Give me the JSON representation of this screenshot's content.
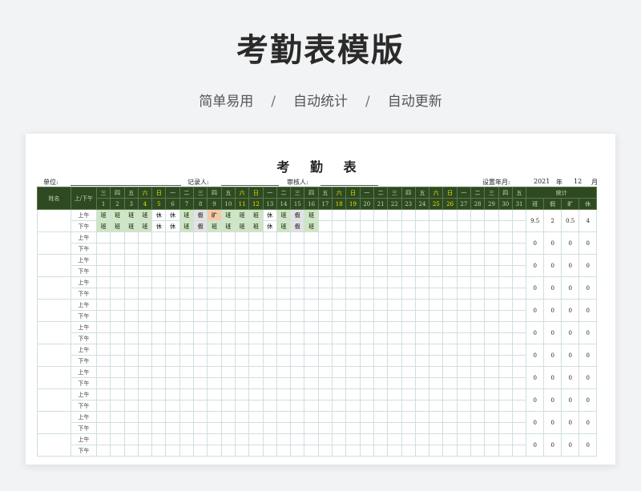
{
  "title": "考勤表模版",
  "subtitle": {
    "items": [
      "简单易用",
      "自动统计",
      "自动更新"
    ],
    "separator": "/"
  },
  "sheet": {
    "title": "考 勤 表",
    "unit_label": "单位:",
    "recorder_label": "记录人:",
    "reviewer_label": "审核人:",
    "set_label": "设置年月:",
    "year": "2021",
    "year_unit": "年",
    "month": "12",
    "month_unit": "月",
    "name_header": "姓名",
    "half_header": "上/下午",
    "stats_header": "统计",
    "stat_cols": [
      "班",
      "假",
      "旷",
      "休"
    ],
    "weekdays": [
      "三",
      "四",
      "五",
      "六",
      "日",
      "一",
      "二",
      "三",
      "四",
      "五",
      "六",
      "日",
      "一",
      "二",
      "三",
      "四",
      "五",
      "六",
      "日",
      "一",
      "二",
      "三",
      "四",
      "五",
      "六",
      "日",
      "一",
      "二",
      "三",
      "四",
      "五"
    ],
    "days": [
      "1",
      "2",
      "3",
      "4",
      "5",
      "6",
      "7",
      "8",
      "9",
      "10",
      "11",
      "12",
      "13",
      "14",
      "15",
      "16",
      "17",
      "18",
      "19",
      "20",
      "21",
      "22",
      "23",
      "24",
      "25",
      "26",
      "27",
      "28",
      "29",
      "30",
      "31"
    ],
    "half_labels": [
      "上午",
      "下午"
    ],
    "rows": [
      {
        "am": [
          "班",
          "班",
          "班",
          "班",
          "休",
          "休",
          "班",
          "假",
          "旷",
          "班",
          "班",
          "班",
          "休",
          "班",
          "假",
          "班"
        ],
        "pm": [
          "班",
          "班",
          "班",
          "班",
          "休",
          "休",
          "班",
          "假",
          "班",
          "班",
          "班",
          "班",
          "休",
          "班",
          "假",
          "班"
        ],
        "stats": [
          "9.5",
          "2",
          "0.5",
          "4"
        ]
      },
      {
        "am": [],
        "pm": [],
        "stats": [
          "0",
          "0",
          "0",
          "0"
        ]
      },
      {
        "am": [],
        "pm": [],
        "stats": [
          "0",
          "0",
          "0",
          "0"
        ]
      },
      {
        "am": [],
        "pm": [],
        "stats": [
          "0",
          "0",
          "0",
          "0"
        ]
      },
      {
        "am": [],
        "pm": [],
        "stats": [
          "0",
          "0",
          "0",
          "0"
        ]
      },
      {
        "am": [],
        "pm": [],
        "stats": [
          "0",
          "0",
          "0",
          "0"
        ]
      },
      {
        "am": [],
        "pm": [],
        "stats": [
          "0",
          "0",
          "0",
          "0"
        ]
      },
      {
        "am": [],
        "pm": [],
        "stats": [
          "0",
          "0",
          "0",
          "0"
        ]
      },
      {
        "am": [],
        "pm": [],
        "stats": [
          "0",
          "0",
          "0",
          "0"
        ]
      },
      {
        "am": [],
        "pm": [],
        "stats": [
          "0",
          "0",
          "0",
          "0"
        ]
      },
      {
        "am": [],
        "pm": [],
        "stats": [
          "0",
          "0",
          "0",
          "0"
        ]
      }
    ]
  },
  "colors": {
    "header_green": "#2e4a22",
    "weekend_yellow": "#f2e300",
    "work": "#cfe6c3",
    "leave": "#e3e3e3",
    "absent": "#f6c9a6"
  }
}
